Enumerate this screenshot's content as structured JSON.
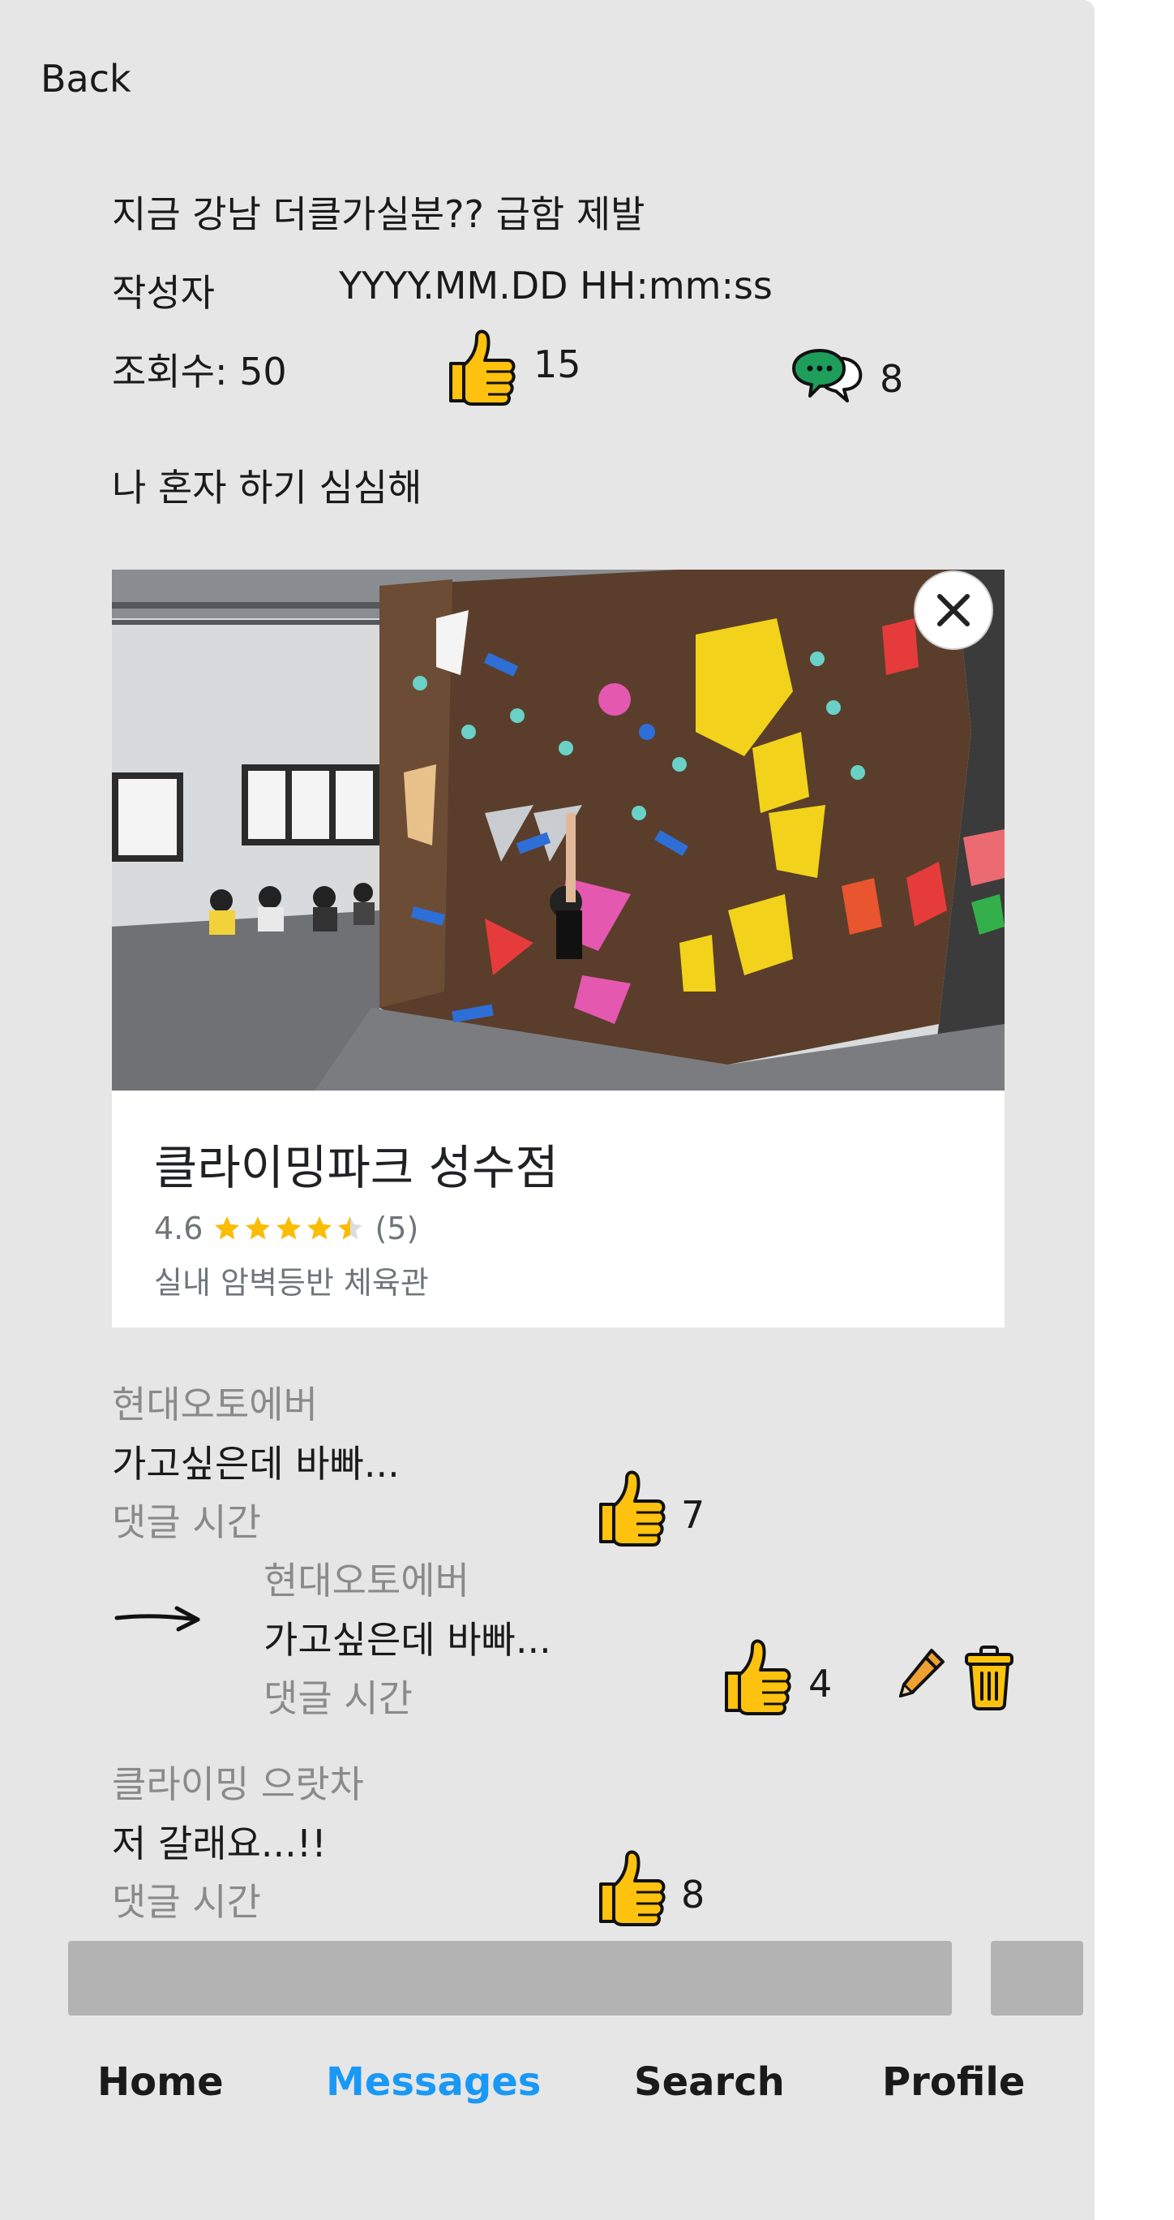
{
  "header": {
    "back_label": "Back"
  },
  "post": {
    "title": "지금 강남 더클가실분?? 급함 제발",
    "author": "작성자",
    "datetime": "YYYY.MM.DD HH:mm:ss",
    "views": "조회수: 50",
    "likes": "15",
    "comments_count": "8",
    "body": "나 혼자 하기 심심해"
  },
  "place_card": {
    "name": "클라이밍파크 성수점",
    "rating": "4.6",
    "rating_value": 4.6,
    "review_count": "(5)",
    "category": "실내 암벽등반 체육관"
  },
  "comments": [
    {
      "author": "현대오토에버",
      "text": "가고싶은데 바빠...",
      "time": "댓글 시간",
      "likes": "7"
    },
    {
      "author": "현대오토에버",
      "text": "가고싶은데 바빠...",
      "time": "댓글 시간",
      "likes": "4"
    },
    {
      "author": "클라이밍 으랏차",
      "text": "저 갈래요...!!",
      "time": "댓글 시간",
      "likes": "8"
    }
  ],
  "nav": {
    "items": [
      "Home",
      "Messages",
      "Search",
      "Profile"
    ],
    "active": "Messages",
    "active_color": "#1a98f5"
  },
  "colors": {
    "thumb": "#ffc20e",
    "comment_icon": "#1e9e5a",
    "pencil": "#f0a030",
    "trash": "#ffc20e"
  }
}
